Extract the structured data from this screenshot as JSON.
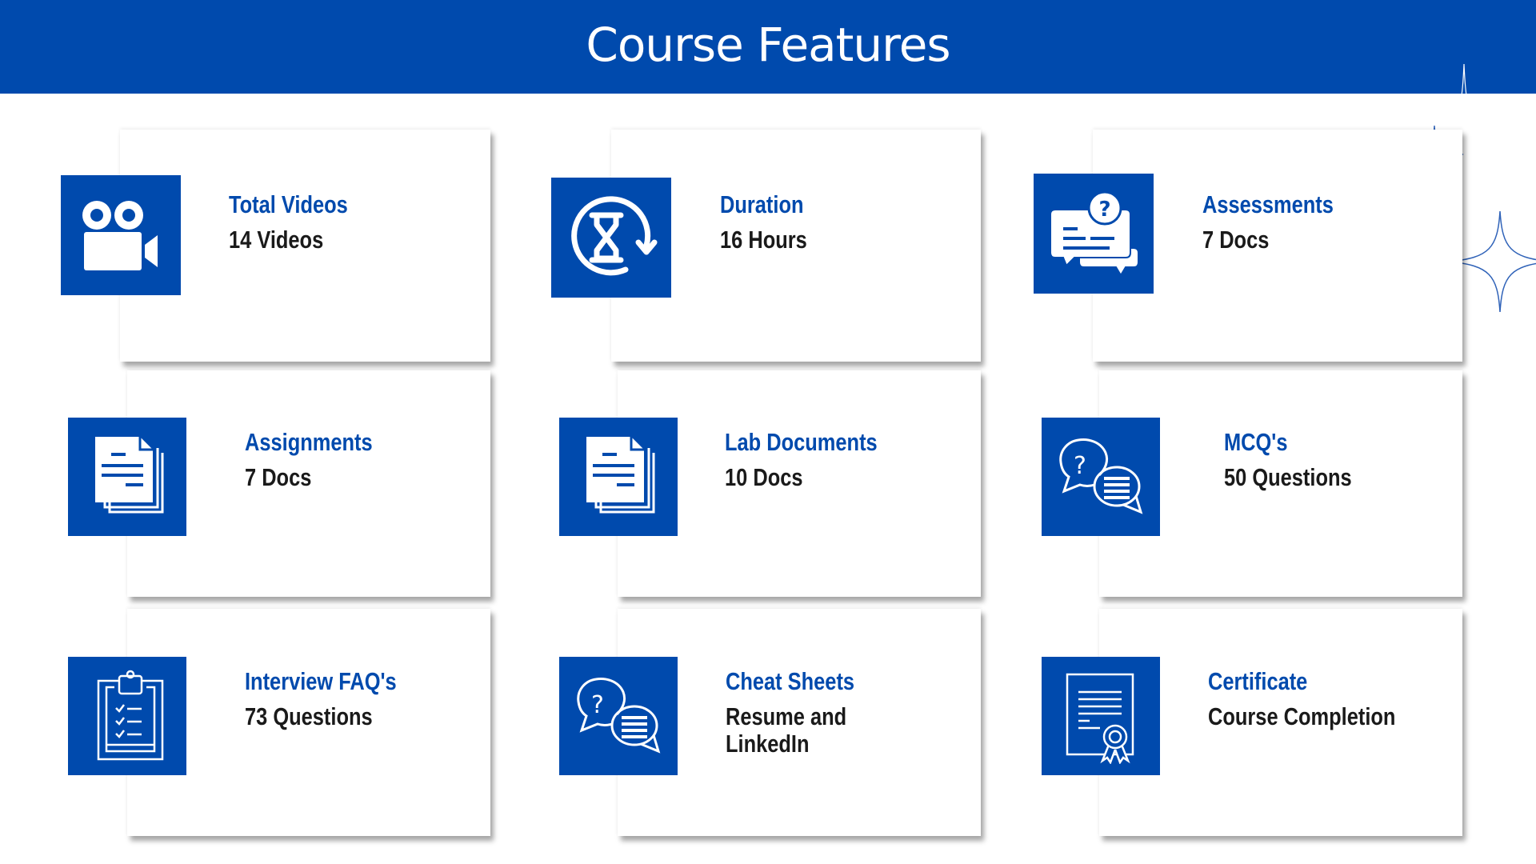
{
  "header": {
    "title": "Course Features"
  },
  "colors": {
    "brand": "#004AAD",
    "value_text": "#1a1a1a",
    "background": "#ffffff"
  },
  "features": [
    {
      "title": "Total Videos",
      "value": "14 Videos",
      "icon": "video-camera-icon"
    },
    {
      "title": "Duration",
      "value": "16 Hours",
      "icon": "hourglass-refresh-icon"
    },
    {
      "title": "Assessments",
      "value": "7 Docs",
      "icon": "question-chat-icon"
    },
    {
      "title": "Assignments",
      "value": "7 Docs",
      "icon": "documents-icon"
    },
    {
      "title": "Lab Documents",
      "value": "10 Docs",
      "icon": "documents-icon"
    },
    {
      "title": "MCQ's",
      "value": "50 Questions",
      "icon": "question-speech-bubbles-icon"
    },
    {
      "title": "Interview FAQ's",
      "value": "73 Questions",
      "icon": "clipboard-checklist-icon"
    },
    {
      "title": "Cheat Sheets",
      "value_lines": [
        "Resume and",
        "LinkedIn"
      ],
      "icon": "question-speech-bubbles-icon"
    },
    {
      "title": "Certificate",
      "value": "Course Completion",
      "icon": "certificate-icon"
    }
  ]
}
